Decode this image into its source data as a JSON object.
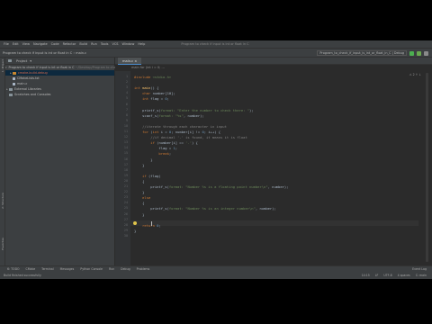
{
  "menu": [
    "File",
    "Edit",
    "View",
    "Navigate",
    "Code",
    "Refactor",
    "Build",
    "Run",
    "Tools",
    "VCS",
    "Window",
    "Help"
  ],
  "window_title": "Program to check if input is int or float in C",
  "nav": {
    "crumb_project": "Program to check if input is int or float in C",
    "crumb_file": "main.c",
    "run_config": "Program_to_check_if_input_is_int_or_float_in_C | Debug"
  },
  "left_strip": {
    "top": "1: Project",
    "middle": "2: Structure",
    "bottom": "Favorites"
  },
  "project_panel": {
    "title": "Project",
    "root": "Program to check if input is int or float in C",
    "root_path": "~/Desktop/Program to check if input",
    "items": [
      {
        "label": "cmake-build-debug",
        "red": true
      },
      {
        "label": "CMakeLists.txt",
        "red": false
      },
      {
        "label": "main.c",
        "red": false
      }
    ],
    "external": "External Libraries",
    "scratches": "Scratches and Consoles"
  },
  "editor": {
    "tab": "main.c",
    "breadcrumb": "main   for (int i = 0; ...",
    "indicators": "⚠ 2  ↑  ↓"
  },
  "code_lines": [
    {
      "n": "1",
      "segs": [
        {
          "t": "#include ",
          "c": "kw"
        },
        {
          "t": "<stdio.h>",
          "c": "str"
        }
      ]
    },
    {
      "n": "2",
      "segs": []
    },
    {
      "n": "3",
      "segs": [
        {
          "t": "int ",
          "c": "kw"
        },
        {
          "t": "main",
          "c": "fn"
        },
        {
          "t": "() {",
          "c": "id"
        }
      ]
    },
    {
      "n": "4",
      "segs": [
        {
          "t": "    char ",
          "c": "kw"
        },
        {
          "t": "number[10];",
          "c": "id"
        }
      ]
    },
    {
      "n": "5",
      "segs": [
        {
          "t": "    int ",
          "c": "kw"
        },
        {
          "t": "flag = ",
          "c": "id"
        },
        {
          "t": "0",
          "c": "num"
        },
        {
          "t": ";",
          "c": "id"
        }
      ]
    },
    {
      "n": "6",
      "segs": []
    },
    {
      "n": "7",
      "segs": [
        {
          "t": "    printf_s(",
          "c": "id"
        },
        {
          "t": "format: \"Enter the number to check there: \"",
          "c": "str"
        },
        {
          "t": ");",
          "c": "id"
        }
      ]
    },
    {
      "n": "8",
      "segs": [
        {
          "t": "    scanf_s(",
          "c": "id"
        },
        {
          "t": "format: \"%s\"",
          "c": "str"
        },
        {
          "t": ", number);",
          "c": "id"
        }
      ]
    },
    {
      "n": "9",
      "segs": []
    },
    {
      "n": "10",
      "segs": [
        {
          "t": "    //iterate through each character in input",
          "c": "cmt"
        }
      ]
    },
    {
      "n": "11",
      "segs": [
        {
          "t": "    for ",
          "c": "kw"
        },
        {
          "t": "(",
          "c": "id"
        },
        {
          "t": "int ",
          "c": "kw"
        },
        {
          "t": "i = ",
          "c": "id"
        },
        {
          "t": "0",
          "c": "num"
        },
        {
          "t": "; number[i] != ",
          "c": "id"
        },
        {
          "t": "0",
          "c": "num"
        },
        {
          "t": "; i++) {",
          "c": "id"
        }
      ]
    },
    {
      "n": "12",
      "segs": [
        {
          "t": "        //if decimal '.' is found, it means it is float",
          "c": "cmt"
        }
      ]
    },
    {
      "n": "13",
      "segs": [
        {
          "t": "        if ",
          "c": "kw"
        },
        {
          "t": "(number[i] == ",
          "c": "id"
        },
        {
          "t": "'.'",
          "c": "str"
        },
        {
          "t": ") {",
          "c": "id"
        }
      ]
    },
    {
      "n": "14",
      "segs": [
        {
          "t": "            flag = ",
          "c": "id"
        },
        {
          "t": "1",
          "c": "num"
        },
        {
          "t": ";",
          "c": "id"
        }
      ]
    },
    {
      "n": "15",
      "segs": [
        {
          "t": "            break",
          "c": "kw"
        },
        {
          "t": ";",
          "c": "id"
        }
      ]
    },
    {
      "n": "16",
      "segs": [
        {
          "t": "        }",
          "c": "id"
        }
      ]
    },
    {
      "n": "17",
      "segs": [
        {
          "t": "    }",
          "c": "id"
        }
      ]
    },
    {
      "n": "18",
      "segs": []
    },
    {
      "n": "19",
      "segs": [
        {
          "t": "    if ",
          "c": "kw"
        },
        {
          "t": "(flag)",
          "c": "id"
        }
      ]
    },
    {
      "n": "20",
      "segs": [
        {
          "t": "    {",
          "c": "id"
        }
      ]
    },
    {
      "n": "21",
      "segs": [
        {
          "t": "        printf_s(",
          "c": "id"
        },
        {
          "t": "format: \"Number %s is a floating point number\\n\"",
          "c": "str"
        },
        {
          "t": ", number);",
          "c": "id"
        }
      ]
    },
    {
      "n": "22",
      "segs": [
        {
          "t": "    }",
          "c": "id"
        }
      ]
    },
    {
      "n": "23",
      "segs": [
        {
          "t": "    else",
          "c": "kw"
        }
      ]
    },
    {
      "n": "24",
      "segs": [
        {
          "t": "    {",
          "c": "id"
        }
      ]
    },
    {
      "n": "25",
      "segs": [
        {
          "t": "        printf_s(",
          "c": "id"
        },
        {
          "t": "format: \"Number %s is an integer number\\n\"",
          "c": "str"
        },
        {
          "t": ", number);",
          "c": "id"
        }
      ]
    },
    {
      "n": "26",
      "segs": [
        {
          "t": "    }",
          "c": "id"
        }
      ]
    },
    {
      "n": "27",
      "segs": []
    },
    {
      "n": "28",
      "segs": [
        {
          "t": "    return ",
          "c": "kw"
        },
        {
          "t": "0",
          "c": "num"
        },
        {
          "t": ";",
          "c": "id"
        }
      ]
    },
    {
      "n": "29",
      "segs": [
        {
          "t": "}",
          "c": "id"
        }
      ]
    },
    {
      "n": "30",
      "segs": []
    }
  ],
  "tool_tabs": [
    "6: TODO",
    "CMake",
    "Terminal",
    "Messages",
    "Python Console",
    "Run",
    "Debug",
    "Problems",
    "Event Log"
  ],
  "status": {
    "message": "Build finished successfully",
    "position": "14:15",
    "line_sep": "LF",
    "encoding": "UTF-8",
    "indent": "4 spaces",
    "context": "C: main"
  },
  "colors": {
    "kw": "#cc7832",
    "str": "#6a8759",
    "num": "#6897bb",
    "cmt": "#808080",
    "fn": "#ffc66d",
    "id": "#a9b7c6"
  }
}
